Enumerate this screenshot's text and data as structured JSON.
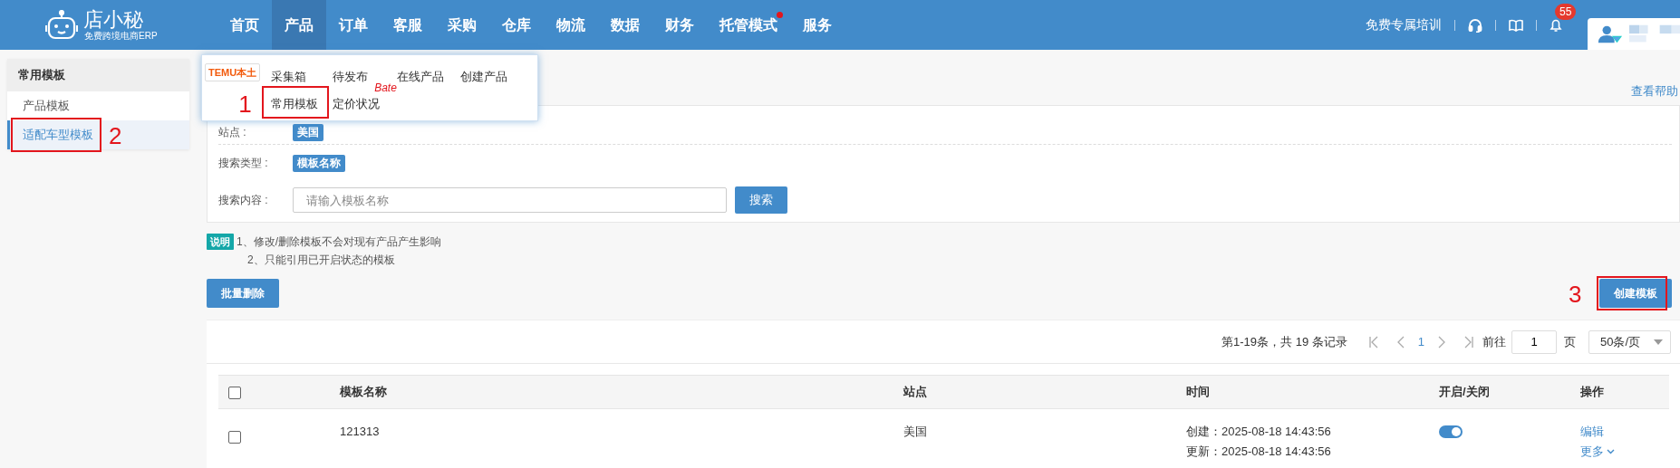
{
  "app": {
    "name": "店小秘",
    "tagline": "免费跨境电商ERP"
  },
  "nav": [
    {
      "label": "首页",
      "selected": false,
      "dot": false
    },
    {
      "label": "产品",
      "selected": true,
      "dot": false
    },
    {
      "label": "订单",
      "selected": false,
      "dot": false
    },
    {
      "label": "客服",
      "selected": false,
      "dot": false
    },
    {
      "label": "采购",
      "selected": false,
      "dot": false
    },
    {
      "label": "仓库",
      "selected": false,
      "dot": false
    },
    {
      "label": "物流",
      "selected": false,
      "dot": false
    },
    {
      "label": "数据",
      "selected": false,
      "dot": false
    },
    {
      "label": "财务",
      "selected": false,
      "dot": false
    },
    {
      "label": "托管模式",
      "selected": false,
      "dot": true
    },
    {
      "label": "服务",
      "selected": false,
      "dot": false
    }
  ],
  "header_right": {
    "training": "免费专属培训",
    "notification_count": "55"
  },
  "product_menu": {
    "platform": "TEMU本土",
    "rows": [
      [
        {
          "label": "采集箱"
        },
        {
          "label": "待发布"
        },
        {
          "label": "在线产品"
        },
        {
          "label": "创建产品"
        }
      ],
      [
        {
          "label": "常用模板",
          "callout": "1"
        },
        {
          "label": "定价状况",
          "tag": "Bate"
        }
      ]
    ]
  },
  "sidebar": {
    "title": "常用模板",
    "items": [
      {
        "label": "产品模板",
        "selected": false
      },
      {
        "label": "适配车型模板",
        "selected": true,
        "callout": "2"
      }
    ]
  },
  "help_link": "查看帮助",
  "filters": [
    {
      "kind": "tag",
      "label": "站点 :",
      "value": "美国"
    },
    {
      "kind": "tag",
      "label": "搜索类型 :",
      "value": "模板名称"
    },
    {
      "kind": "input",
      "label": "搜索内容 :",
      "placeholder": "请输入模板名称",
      "button": "搜索"
    }
  ],
  "notes": {
    "badge": "说明",
    "lines": [
      "1、修改/删除模板不会对现有产品产生影响",
      "2、只能引用已开启状态的模板"
    ]
  },
  "actions": {
    "bulk_delete": "批量删除",
    "create": {
      "label": "创建模板",
      "callout": "3"
    }
  },
  "pagination": {
    "summary": "第1-19条，共 19 条记录",
    "current": "1",
    "goto_label": "前往",
    "goto_value": "1",
    "page_unit": "页",
    "page_size": "50条/页"
  },
  "table": {
    "select_all_checked": false,
    "columns": [
      "模板名称",
      "站点",
      "时间",
      "开启/关闭",
      "操作"
    ],
    "rows": [
      {
        "checked": false,
        "name": "121313",
        "site": "美国",
        "created": "创建：2025-08-18 14:43:56",
        "updated": "更新：2025-08-18 14:43:56",
        "on": true,
        "actions": [
          "编辑",
          "更多"
        ]
      }
    ]
  }
}
